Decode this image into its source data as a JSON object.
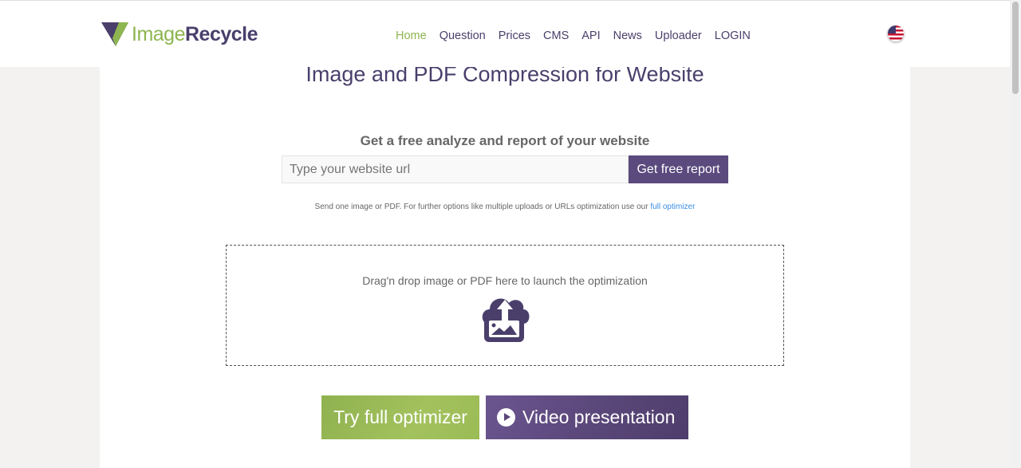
{
  "header": {
    "logo": {
      "part1": "Image",
      "part2": "Recycle"
    },
    "nav": [
      {
        "label": "Home",
        "active": true
      },
      {
        "label": "Question"
      },
      {
        "label": "Prices"
      },
      {
        "label": "CMS"
      },
      {
        "label": "API"
      },
      {
        "label": "News"
      },
      {
        "label": "Uploader"
      },
      {
        "label": "LOGIN"
      }
    ],
    "language_icon": "us-flag-icon"
  },
  "main": {
    "title": "Image and PDF Compression for Website",
    "report_heading": "Get a free analyze and report of your website",
    "url_placeholder": "Type your website url",
    "url_value": "",
    "report_button": "Get free report",
    "note": "Send one image or PDF. For further options like multiple uploads or URLs optimization use our",
    "note_link": "full optimizer",
    "dropzone_text": "Drag'n drop image or PDF here to launch the optimization",
    "dropzone_icon": "cloud-upload-image-icon",
    "try_button": "Try full optimizer",
    "video_button": "Video presentation"
  },
  "colors": {
    "green": "#8eb550",
    "purple": "#4a3f6b"
  }
}
